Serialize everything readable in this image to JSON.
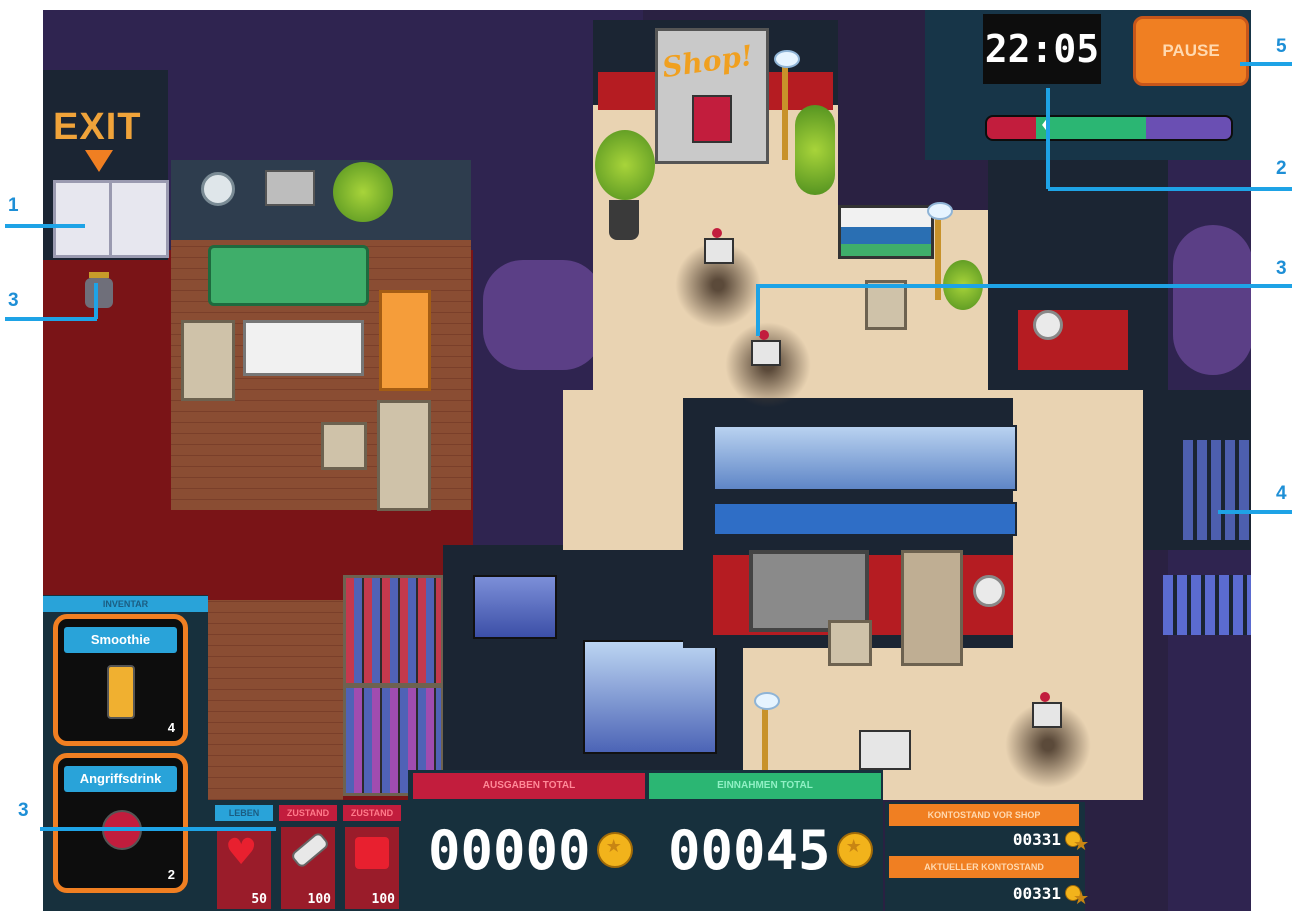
{
  "scene": {
    "exit_sign": "EXIT",
    "shop_sign": "Shop!"
  },
  "hud": {
    "clock": "22:05",
    "pause_label": "PAUSE",
    "status_bar": {
      "red": 0.2,
      "green": 0.45,
      "purple": 0.35
    }
  },
  "inventory": {
    "header": "INVENTAR",
    "items": [
      {
        "name": "Smoothie",
        "count": "4",
        "icon": "smoothie-bottle-icon"
      },
      {
        "name": "Angriffsdrink",
        "count": "2",
        "icon": "attack-drink-flask-icon"
      }
    ]
  },
  "stats": [
    {
      "label": "LEBEN",
      "value": "50",
      "icon": "heart-icon",
      "color": "#29a3d9"
    },
    {
      "label": "ZUSTAND",
      "value": "100",
      "icon": "bandage-icon",
      "color": "#c21d3d"
    },
    {
      "label": "ZUSTAND",
      "value": "100",
      "icon": "shirt-icon",
      "color": "#c21d3d"
    }
  ],
  "totals": {
    "spent_label": "AUSGABEN TOTAL",
    "spent_value": "00000",
    "income_label": "EINNAHMEN TOTAL",
    "income_value": "00045"
  },
  "balance": {
    "before_shop_label": "KONTOSTAND VOR SHOP",
    "before_shop_value": "00331",
    "current_label": "AKTUELLER KONTOSTAND",
    "current_value": "00331"
  },
  "callouts": [
    "1",
    "2",
    "3",
    "3",
    "3",
    "4",
    "5"
  ],
  "colors": {
    "accent_orange": "#f07f22",
    "accent_blue": "#1ea3e6",
    "panel_dark": "#17303d",
    "spent_red": "#c21d3d",
    "income_green": "#2bb673"
  }
}
